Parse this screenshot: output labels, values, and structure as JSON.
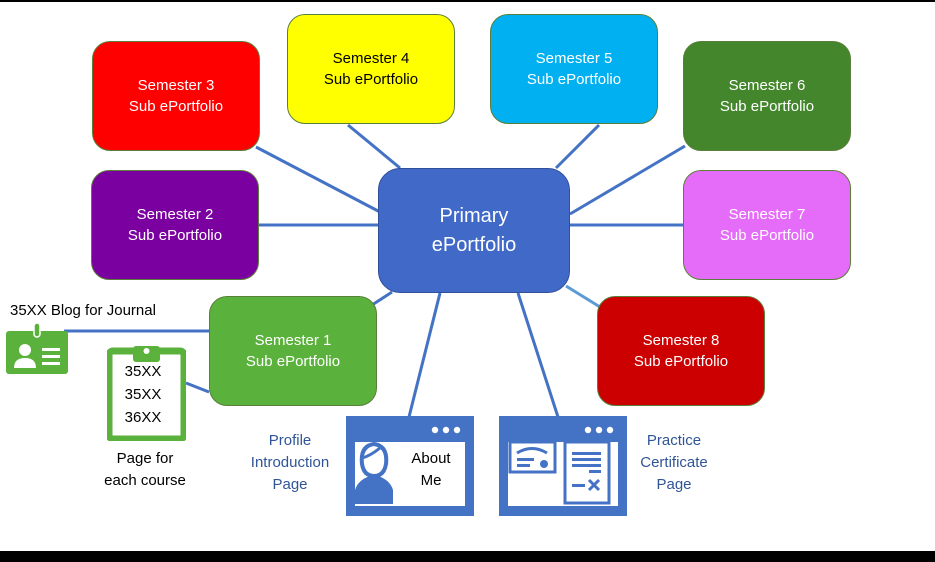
{
  "diagram": {
    "center": {
      "line1": "Primary",
      "line2": "ePortfolio",
      "color": "#4169c8"
    },
    "semesters": [
      {
        "id": "s1",
        "line1": "Semester 1",
        "line2": "Sub ePortfolio",
        "color": "#5ab13b",
        "text_color": "#ffffff"
      },
      {
        "id": "s2",
        "line1": "Semester 2",
        "line2": "Sub ePortfolio",
        "color": "#7a00a0",
        "text_color": "#ffffff"
      },
      {
        "id": "s3",
        "line1": "Semester 3",
        "line2": "Sub ePortfolio",
        "color": "#ff0000",
        "text_color": "#ffffff"
      },
      {
        "id": "s4",
        "line1": "Semester 4",
        "line2": "Sub ePortfolio",
        "color": "#ffff00",
        "text_color": "#000000"
      },
      {
        "id": "s5",
        "line1": "Semester 5",
        "line2": "Sub ePortfolio",
        "color": "#00b0f0",
        "text_color": "#ffffff"
      },
      {
        "id": "s6",
        "line1": "Semester 6",
        "line2": "Sub ePortfolio",
        "color": "#44862c",
        "text_color": "#ffffff"
      },
      {
        "id": "s7",
        "line1": "Semester 7",
        "line2": "Sub ePortfolio",
        "color": "#e56cf8",
        "text_color": "#ffffff"
      },
      {
        "id": "s8",
        "line1": "Semester 8",
        "line2": "Sub ePortfolio",
        "color": "#cc0000",
        "text_color": "#ffffff"
      }
    ],
    "blog": {
      "label": "35XX Blog for Journal",
      "icon": "id-badge-icon",
      "color": "#5ab13b"
    },
    "course_pages": {
      "icon": "clipboard-icon",
      "items": [
        "35XX",
        "35XX",
        "36XX"
      ],
      "caption_line1": "Page for",
      "caption_line2": "each course",
      "color": "#5ab13b"
    },
    "profile_page": {
      "icon": "web-profile-icon",
      "inner_line1": "About",
      "inner_line2": "Me",
      "caption_line1": "Profile",
      "caption_line2": "Introduction",
      "caption_line3": "Page",
      "caption_color": "#2f5597"
    },
    "certificate_page": {
      "icon": "web-certificate-icon",
      "caption_line1": "Practice",
      "caption_line2": "Certificate",
      "caption_line3": "Page",
      "caption_color": "#2f5597"
    },
    "connector_color": "#4472c4"
  }
}
